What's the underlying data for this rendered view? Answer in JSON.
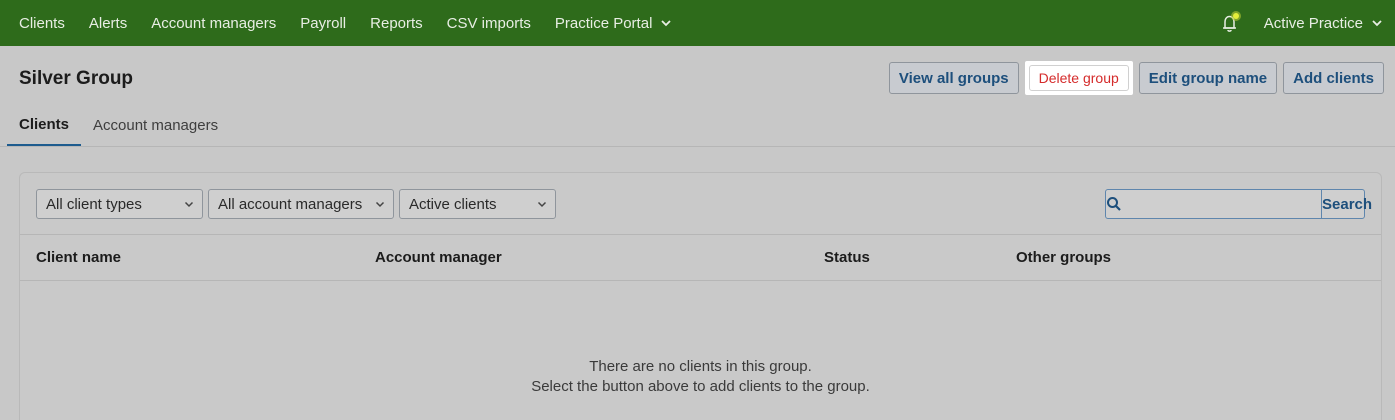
{
  "nav": {
    "items": [
      "Clients",
      "Alerts",
      "Account managers",
      "Payroll",
      "Reports",
      "CSV imports",
      "Practice Portal"
    ],
    "practice": "Active Practice"
  },
  "page": {
    "title": "Silver Group",
    "actions": {
      "view_all": "View all groups",
      "delete": "Delete group",
      "edit": "Edit group name",
      "add": "Add clients"
    }
  },
  "tabs": [
    "Clients",
    "Account managers"
  ],
  "filters": {
    "client_types": "All client types",
    "account_managers": "All account managers",
    "status": "Active clients"
  },
  "search": {
    "placeholder": "",
    "button": "Search"
  },
  "table": {
    "headers": [
      "Client name",
      "Account manager",
      "Status",
      "Other groups"
    ]
  },
  "empty": {
    "line1": "There are no clients in this group.",
    "line2": "Select the button above to add clients to the group."
  },
  "colors": {
    "nav_bg": "#2e6b1b",
    "link": "#1d4f7c",
    "danger": "#d52b2b",
    "tab_underline": "#1d5b8e"
  }
}
